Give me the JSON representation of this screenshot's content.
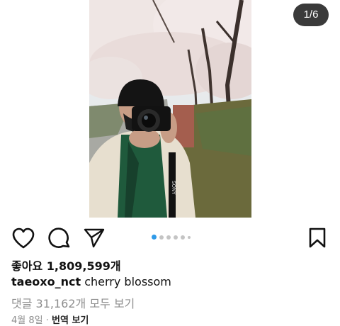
{
  "carousel": {
    "counter": "1/6",
    "total": 6,
    "current": 1,
    "active_color": "#2f9ae8",
    "inactive_color": "#c4c4c4"
  },
  "actions": {
    "like_icon": "heart-outline",
    "comment_icon": "speech-bubble",
    "share_icon": "paper-plane",
    "save_icon": "bookmark-outline"
  },
  "likes": {
    "label": "좋아요",
    "count": "1,809,599개"
  },
  "caption": {
    "username": "taeoxo_nct",
    "text": "cherry blossom"
  },
  "comments": {
    "view_all": "댓글 31,162개 모두 보기"
  },
  "meta": {
    "date": "4월 8일",
    "separator": " · ",
    "translate": "번역 보기"
  }
}
